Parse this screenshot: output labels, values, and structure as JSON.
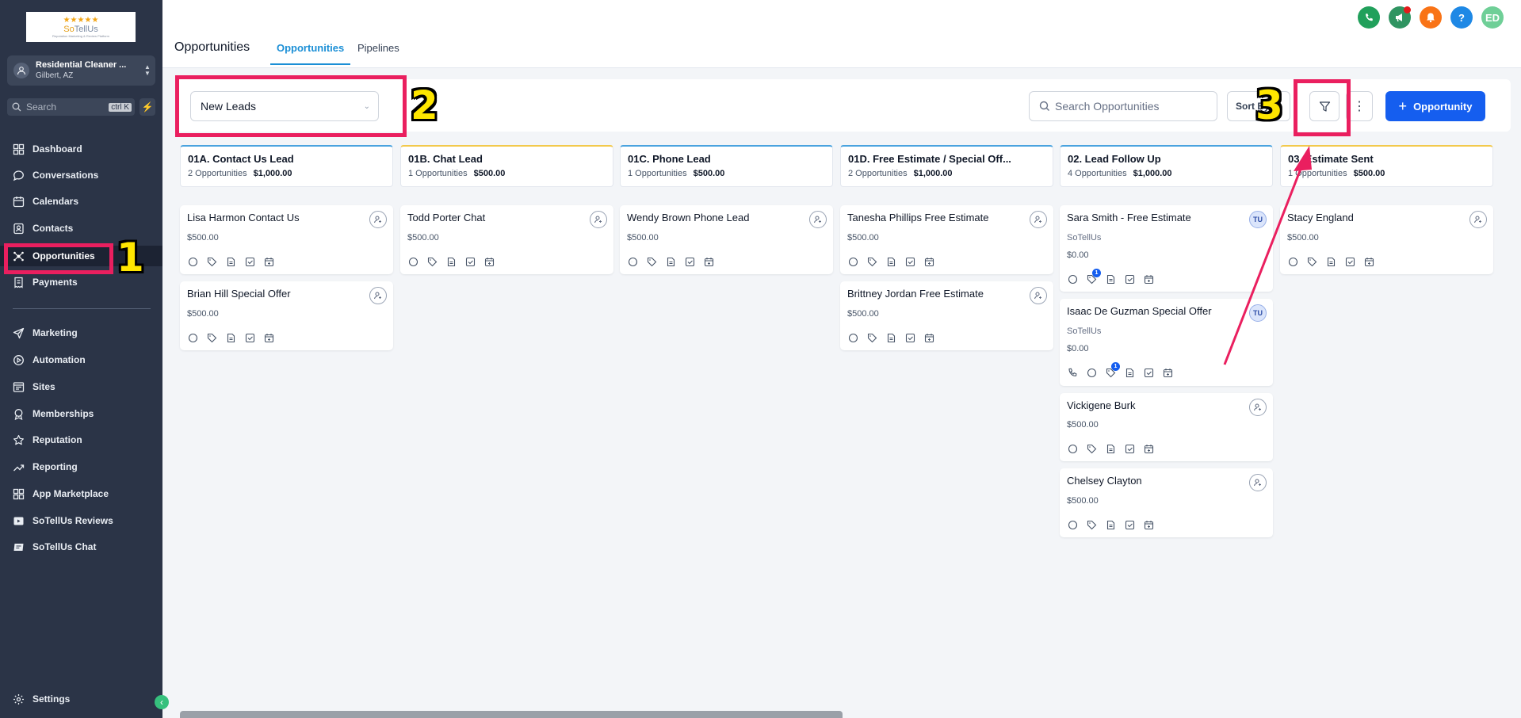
{
  "logo": {
    "brand_a": "So",
    "brand_b": "Tell",
    "brand_c": "Us",
    "tagline": "Reputation Marketing & Review Platform"
  },
  "account": {
    "name": "Residential Cleaner ...",
    "location": "Gilbert, AZ"
  },
  "search": {
    "placeholder": "Search",
    "shortcut": "ctrl K"
  },
  "nav": [
    {
      "label": "Dashboard",
      "icon": "dashboard-icon"
    },
    {
      "label": "Conversations",
      "icon": "chat-icon"
    },
    {
      "label": "Calendars",
      "icon": "calendar-icon"
    },
    {
      "label": "Contacts",
      "icon": "contacts-icon"
    },
    {
      "label": "Opportunities",
      "icon": "opportunities-icon",
      "active": true
    },
    {
      "label": "Payments",
      "icon": "payments-icon"
    },
    {
      "label": "Marketing",
      "icon": "send-icon"
    },
    {
      "label": "Automation",
      "icon": "automation-icon"
    },
    {
      "label": "Sites",
      "icon": "sites-icon"
    },
    {
      "label": "Memberships",
      "icon": "memberships-icon"
    },
    {
      "label": "Reputation",
      "icon": "star-icon"
    },
    {
      "label": "Reporting",
      "icon": "trend-icon"
    },
    {
      "label": "App Marketplace",
      "icon": "grid-icon"
    },
    {
      "label": "SoTellUs Reviews",
      "icon": "video-icon"
    },
    {
      "label": "SoTellUs Chat",
      "icon": "chat-card-icon"
    }
  ],
  "settings_label": "Settings",
  "header": {
    "title": "Opportunities",
    "tabs": [
      {
        "label": "Opportunities",
        "active": true
      },
      {
        "label": "Pipelines"
      }
    ],
    "avatar_initials": "ED"
  },
  "toolbar": {
    "pipeline": "New Leads",
    "search_placeholder": "Search Opportunities",
    "sort_label": "Sort By",
    "add_label": "Opportunity"
  },
  "columns": [
    {
      "title": "01A. Contact Us Lead",
      "count": "2 Opportunities",
      "amount": "$1,000.00",
      "accent": "#4aa3df"
    },
    {
      "title": "01B. Chat Lead",
      "count": "1 Opportunities",
      "amount": "$500.00",
      "accent": "#f2c94c"
    },
    {
      "title": "01C. Phone Lead",
      "count": "1 Opportunities",
      "amount": "$500.00",
      "accent": "#4aa3df"
    },
    {
      "title": "01D. Free Estimate / Special Off...",
      "count": "2 Opportunities",
      "amount": "$1,000.00",
      "accent": "#4aa3df"
    },
    {
      "title": "02. Lead Follow Up",
      "count": "4 Opportunities",
      "amount": "$1,000.00",
      "accent": "#4aa3df"
    },
    {
      "title": "03. Estimate Sent",
      "count": "1 Opportunities",
      "amount": "$500.00",
      "accent": "#f2c94c"
    }
  ],
  "cards": [
    {
      "name": "Lisa Harmon Contact Us",
      "amount": "$500.00"
    },
    {
      "name": "Brian Hill Special Offer",
      "amount": "$500.00"
    },
    {
      "name": "Todd Porter Chat",
      "amount": "$500.00"
    },
    {
      "name": "Wendy Brown Phone Lead",
      "amount": "$500.00"
    },
    {
      "name": "Tanesha Phillips Free Estimate",
      "amount": "$500.00"
    },
    {
      "name": "Brittney Jordan Free Estimate",
      "amount": "$500.00"
    },
    {
      "name": "Sara Smith - Free Estimate",
      "company": "SoTellUs",
      "amount": "$0.00",
      "owner": "TU",
      "badge": "1"
    },
    {
      "name": "Isaac De Guzman Special Offer",
      "company": "SoTellUs",
      "amount": "$0.00",
      "owner": "TU",
      "badge": "1"
    },
    {
      "name": "Vickigene Burk",
      "amount": "$500.00"
    },
    {
      "name": "Chelsey Clayton",
      "amount": "$500.00"
    },
    {
      "name": "Stacy England",
      "amount": "$500.00"
    }
  ],
  "annotations": [
    "1",
    "2",
    "3"
  ],
  "colors": {
    "sidebar": "#2b3447",
    "accent": "#155eef",
    "annotation": "#ea1f5f",
    "annotation_number": "#ffe600"
  }
}
